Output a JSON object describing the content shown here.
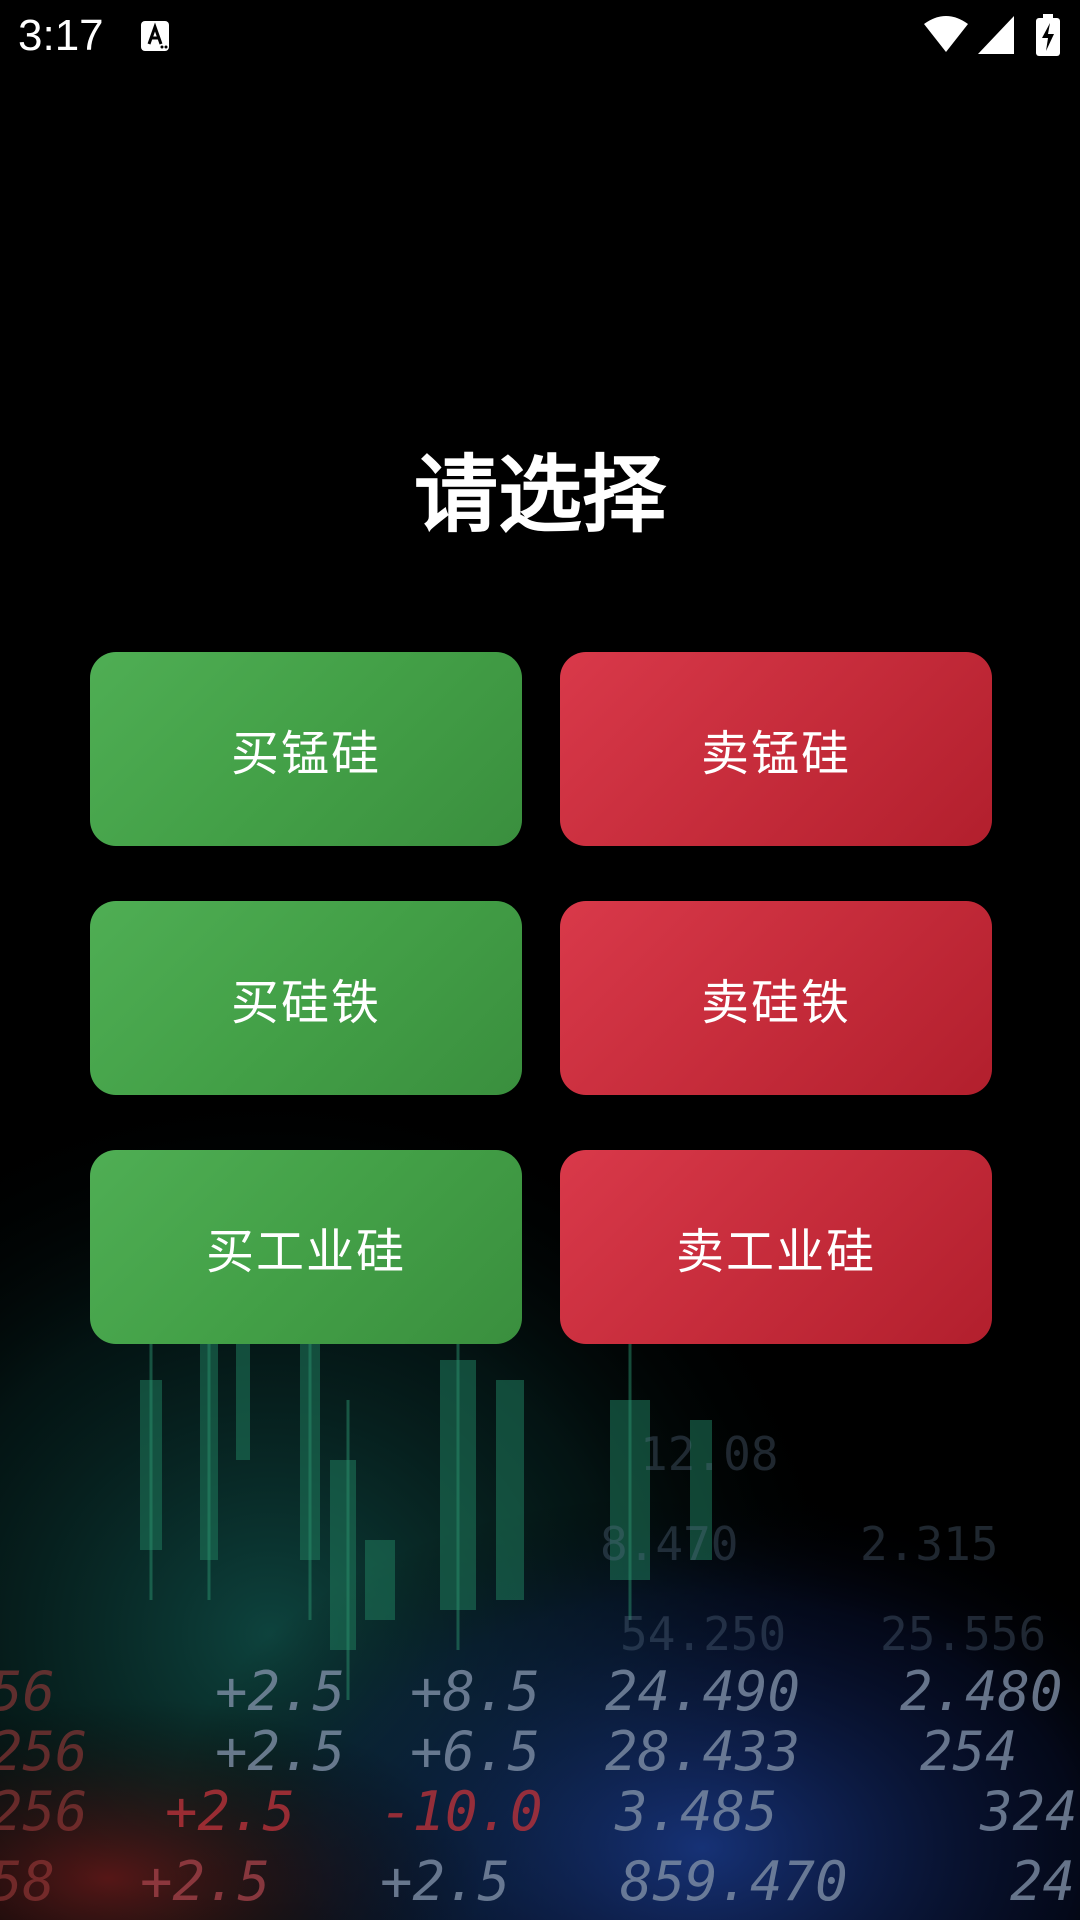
{
  "status_bar": {
    "time": "3:17",
    "icons": [
      "notification-a-icon",
      "wifi-icon",
      "cell-signal-icon",
      "battery-charging-icon"
    ]
  },
  "title": "请选择",
  "options": {
    "buy_mn_si": "买锰硅",
    "sell_mn_si": "卖锰硅",
    "buy_fe_si": "买硅铁",
    "sell_fe_si": "卖硅铁",
    "buy_ind_si": "买工业硅",
    "sell_ind_si": "卖工业硅"
  },
  "colors": {
    "background": "#000000",
    "buy_button": "#43a047",
    "sell_button": "#c62c3b",
    "text": "#ffffff"
  },
  "background_ticker": {
    "rows": [
      [
        "+2.5",
        "+8.5",
        "24.490",
        "2.480"
      ],
      [
        "+2.5",
        "+6.5",
        "28.433",
        "254"
      ],
      [
        "+2.5",
        "-10.0",
        "3.485",
        "324"
      ],
      [
        "+2.5",
        "+2.5",
        "859.470",
        "24"
      ]
    ],
    "faint_rows": [
      [
        "54.250",
        "25.556"
      ]
    ]
  }
}
